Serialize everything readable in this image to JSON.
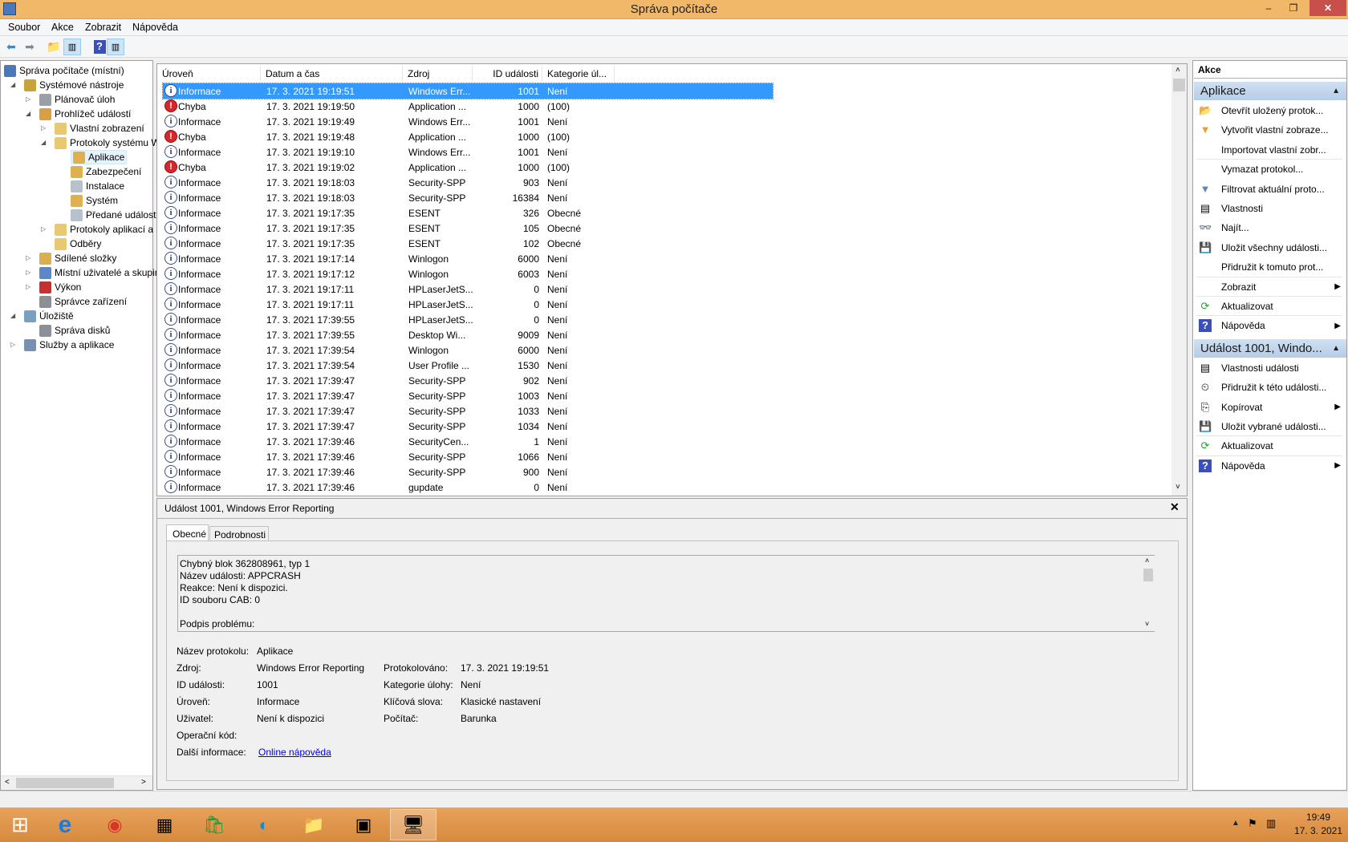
{
  "window": {
    "title": "Správa počítače",
    "minimize": "–",
    "maximize": "❐",
    "close": "✕"
  },
  "menu": [
    "Soubor",
    "Akce",
    "Zobrazit",
    "Nápověda"
  ],
  "toolbar": [
    "back-icon",
    "forward-icon",
    "up-folder-icon",
    "show-hide-tree-icon",
    "help-icon",
    "show-hide-action-pane-icon"
  ],
  "tree": [
    {
      "label": "Správa počítače (místní)",
      "level": 0,
      "arrow": "",
      "icon": "computer-management-icon",
      "color": "#4a78b8"
    },
    {
      "label": "Systémové nástroje",
      "level": 1,
      "arrow": "◢",
      "icon": "tools-icon",
      "color": "#c9a23a"
    },
    {
      "label": "Plánovač úloh",
      "level": 2,
      "arrow": "▷",
      "icon": "clock-icon",
      "color": "#9aa0a8"
    },
    {
      "label": "Prohlížeč událostí",
      "level": 2,
      "arrow": "◢",
      "icon": "event-viewer-icon",
      "color": "#d8a040"
    },
    {
      "label": "Vlastní zobrazení",
      "level": 3,
      "arrow": "▷",
      "icon": "folder-filter-icon",
      "color": "#e8c870"
    },
    {
      "label": "Protokoly systému Windows",
      "level": 3,
      "arrow": "◢",
      "icon": "folder-logs-icon",
      "color": "#e8c870"
    },
    {
      "label": "Aplikace",
      "level": 4,
      "arrow": "",
      "icon": "log-icon",
      "color": "#e0b050",
      "selected": true
    },
    {
      "label": "Zabezpečení",
      "level": 4,
      "arrow": "",
      "icon": "log-icon",
      "color": "#e0b050"
    },
    {
      "label": "Instalace",
      "level": 4,
      "arrow": "",
      "icon": "log-plain-icon",
      "color": "#b8c0cc"
    },
    {
      "label": "Systém",
      "level": 4,
      "arrow": "",
      "icon": "log-icon",
      "color": "#e0b050"
    },
    {
      "label": "Předané události",
      "level": 4,
      "arrow": "",
      "icon": "log-plain-icon",
      "color": "#b8c0cc"
    },
    {
      "label": "Protokoly aplikací a služeb",
      "level": 3,
      "arrow": "▷",
      "icon": "folder-icon",
      "color": "#e8c870"
    },
    {
      "label": "Odběry",
      "level": 3,
      "arrow": "",
      "icon": "subscriptions-icon",
      "color": "#e8c870"
    },
    {
      "label": "Sdílené složky",
      "level": 2,
      "arrow": "▷",
      "icon": "shared-folders-icon",
      "color": "#d8b050"
    },
    {
      "label": "Místní uživatelé a skupiny",
      "level": 2,
      "arrow": "▷",
      "icon": "users-icon",
      "color": "#5a88c8"
    },
    {
      "label": "Výkon",
      "level": 2,
      "arrow": "▷",
      "icon": "performance-icon",
      "color": "#c83030"
    },
    {
      "label": "Správce zařízení",
      "level": 2,
      "arrow": "",
      "icon": "device-manager-icon",
      "color": "#8a8f98"
    },
    {
      "label": "Úložiště",
      "level": 1,
      "arrow": "◢",
      "icon": "storage-icon",
      "color": "#7aa0c0"
    },
    {
      "label": "Správa disků",
      "level": 2,
      "arrow": "",
      "icon": "disk-management-icon",
      "color": "#8a8f98"
    },
    {
      "label": "Služby a aplikace",
      "level": 1,
      "arrow": "▷",
      "icon": "services-icon",
      "color": "#7a90b0"
    }
  ],
  "list": {
    "columns": [
      "Úroveň",
      "Datum a čas",
      "Zdroj",
      "ID události",
      "Kategorie úl..."
    ],
    "rows": [
      [
        "Informace",
        "17. 3. 2021 19:19:51",
        "Windows Err...",
        "1001",
        "Není"
      ],
      [
        "Chyba",
        "17. 3. 2021 19:19:50",
        "Application ...",
        "1000",
        "(100)"
      ],
      [
        "Informace",
        "17. 3. 2021 19:19:49",
        "Windows Err...",
        "1001",
        "Není"
      ],
      [
        "Chyba",
        "17. 3. 2021 19:19:48",
        "Application ...",
        "1000",
        "(100)"
      ],
      [
        "Informace",
        "17. 3. 2021 19:19:10",
        "Windows Err...",
        "1001",
        "Není"
      ],
      [
        "Chyba",
        "17. 3. 2021 19:19:02",
        "Application ...",
        "1000",
        "(100)"
      ],
      [
        "Informace",
        "17. 3. 2021 19:18:03",
        "Security-SPP",
        "903",
        "Není"
      ],
      [
        "Informace",
        "17. 3. 2021 19:18:03",
        "Security-SPP",
        "16384",
        "Není"
      ],
      [
        "Informace",
        "17. 3. 2021 19:17:35",
        "ESENT",
        "326",
        "Obecné"
      ],
      [
        "Informace",
        "17. 3. 2021 19:17:35",
        "ESENT",
        "105",
        "Obecné"
      ],
      [
        "Informace",
        "17. 3. 2021 19:17:35",
        "ESENT",
        "102",
        "Obecné"
      ],
      [
        "Informace",
        "17. 3. 2021 19:17:14",
        "Winlogon",
        "6000",
        "Není"
      ],
      [
        "Informace",
        "17. 3. 2021 19:17:12",
        "Winlogon",
        "6003",
        "Není"
      ],
      [
        "Informace",
        "17. 3. 2021 19:17:11",
        "HPLaserJetS...",
        "0",
        "Není"
      ],
      [
        "Informace",
        "17. 3. 2021 19:17:11",
        "HPLaserJetS...",
        "0",
        "Není"
      ],
      [
        "Informace",
        "17. 3. 2021 17:39:55",
        "HPLaserJetS...",
        "0",
        "Není"
      ],
      [
        "Informace",
        "17. 3. 2021 17:39:55",
        "Desktop Wi...",
        "9009",
        "Není"
      ],
      [
        "Informace",
        "17. 3. 2021 17:39:54",
        "Winlogon",
        "6000",
        "Není"
      ],
      [
        "Informace",
        "17. 3. 2021 17:39:54",
        "User Profile ...",
        "1530",
        "Není"
      ],
      [
        "Informace",
        "17. 3. 2021 17:39:47",
        "Security-SPP",
        "902",
        "Není"
      ],
      [
        "Informace",
        "17. 3. 2021 17:39:47",
        "Security-SPP",
        "1003",
        "Není"
      ],
      [
        "Informace",
        "17. 3. 2021 17:39:47",
        "Security-SPP",
        "1033",
        "Není"
      ],
      [
        "Informace",
        "17. 3. 2021 17:39:47",
        "Security-SPP",
        "1034",
        "Není"
      ],
      [
        "Informace",
        "17. 3. 2021 17:39:46",
        "SecurityCen...",
        "1",
        "Není"
      ],
      [
        "Informace",
        "17. 3. 2021 17:39:46",
        "Security-SPP",
        "1066",
        "Není"
      ],
      [
        "Informace",
        "17. 3. 2021 17:39:46",
        "Security-SPP",
        "900",
        "Není"
      ],
      [
        "Informace",
        "17. 3. 2021 17:39:46",
        "gupdate",
        "0",
        "Není"
      ]
    ]
  },
  "detail": {
    "title": "Událost 1001, Windows Error Reporting",
    "tabs": [
      "Obecné",
      "Podrobnosti"
    ],
    "description": [
      "Chybný blok 362808961, typ 1",
      "Název události: APPCRASH",
      "Reakce: Není k dispozici.",
      "ID souboru CAB: 0",
      "",
      "Podpis problému:"
    ],
    "fields": {
      "log_name_label": "Název protokolu:",
      "log_name": "Aplikace",
      "source_label": "Zdroj:",
      "source": "Windows Error Reporting",
      "logged_label": "Protokolováno:",
      "logged": "17. 3. 2021 19:19:51",
      "event_id_label": "ID události:",
      "event_id": "1001",
      "task_label": "Kategorie úlohy:",
      "task": "Není",
      "level_label": "Úroveň:",
      "level": "Informace",
      "keywords_label": "Klíčová slova:",
      "keywords": "Klasické nastavení",
      "user_label": "Uživatel:",
      "user": "Není k dispozici",
      "computer_label": "Počítač:",
      "computer": "Barunka",
      "opcode_label": "Operační kód:",
      "more_info_label": "Další informace:",
      "more_info_link": "Online nápověda"
    }
  },
  "actions": {
    "header": "Akce",
    "sections": [
      {
        "title": "Aplikace",
        "items": [
          {
            "label": "Otevřít uložený protok...",
            "icon": "open-folder-icon",
            "glyph": "📂"
          },
          {
            "label": "Vytvořit vlastní zobraze...",
            "icon": "create-filter-icon",
            "glyph": "▼"
          },
          {
            "label": "Importovat vlastní zobr...",
            "icon": "",
            "glyph": ""
          },
          {
            "label": "Vymazat protokol...",
            "icon": "",
            "glyph": "",
            "sep": true
          },
          {
            "label": "Filtrovat aktuální proto...",
            "icon": "filter-icon",
            "glyph": "▼"
          },
          {
            "label": "Vlastnosti",
            "icon": "properties-icon",
            "glyph": "▤"
          },
          {
            "label": "Najít...",
            "icon": "binoculars-icon",
            "glyph": "👓"
          },
          {
            "label": "Uložit všechny události...",
            "icon": "save-icon",
            "glyph": "💾"
          },
          {
            "label": "Přidružit k tomuto prot...",
            "icon": "",
            "glyph": ""
          },
          {
            "label": "Zobrazit",
            "icon": "",
            "glyph": "",
            "sub": true,
            "sep": true
          },
          {
            "label": "Aktualizovat",
            "icon": "refresh-icon",
            "glyph": "⟳",
            "sep": true
          },
          {
            "label": "Nápověda",
            "icon": "help-icon",
            "glyph": "?",
            "sub": true,
            "sep": true
          }
        ]
      },
      {
        "title": "Událost 1001, Windo...",
        "items": [
          {
            "label": "Vlastnosti události",
            "icon": "properties-icon",
            "glyph": "▤"
          },
          {
            "label": "Přidružit k této události...",
            "icon": "attach-task-icon",
            "glyph": "⏲"
          },
          {
            "label": "Kopírovat",
            "icon": "copy-icon",
            "glyph": "⎘",
            "sub": true
          },
          {
            "label": "Uložit vybrané události...",
            "icon": "save-icon",
            "glyph": "💾"
          },
          {
            "label": "Aktualizovat",
            "icon": "refresh-icon",
            "glyph": "⟳",
            "sep": true
          },
          {
            "label": "Nápověda",
            "icon": "help-icon",
            "glyph": "?",
            "sub": true,
            "sep": true
          }
        ]
      }
    ]
  },
  "taskbar": {
    "items": [
      {
        "icon": "windows-start-icon",
        "glyph": "⊞"
      },
      {
        "icon": "internet-explorer-icon",
        "glyph": "e"
      },
      {
        "icon": "chrome-icon",
        "glyph": "◉"
      },
      {
        "icon": "control-panel-icon",
        "glyph": "▦"
      },
      {
        "icon": "store-icon",
        "glyph": "🛍"
      },
      {
        "icon": "edge-icon",
        "glyph": "◐"
      },
      {
        "icon": "file-explorer-icon",
        "glyph": "📁"
      },
      {
        "icon": "photos-icon",
        "glyph": "▣"
      },
      {
        "icon": "computer-management-icon",
        "glyph": "🖥",
        "active": true
      }
    ],
    "time": "19:49",
    "date": "17. 3. 2021"
  },
  "colors": {
    "titlebar": "#f1b86a",
    "selection": "#3399ff",
    "section_header": "#c3d6ec",
    "error": "#d8262b",
    "link": "#0000ee"
  }
}
